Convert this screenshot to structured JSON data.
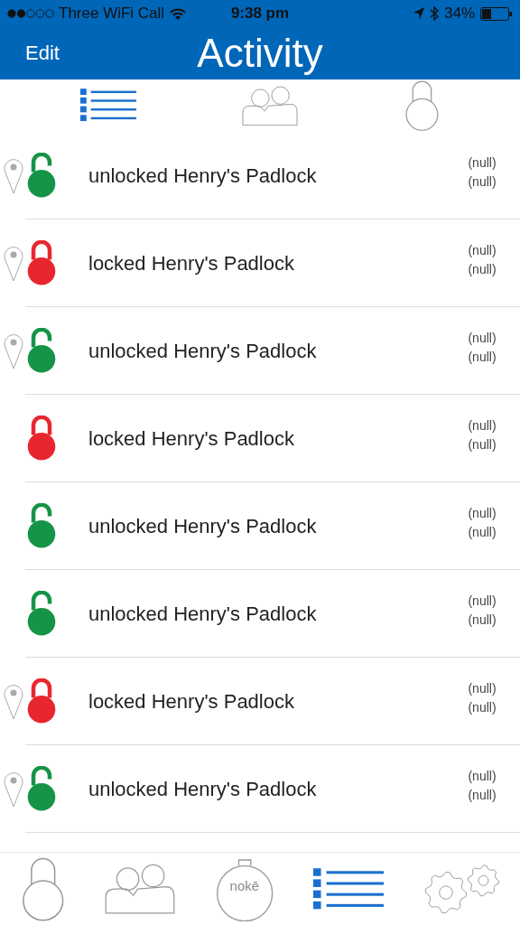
{
  "status_bar": {
    "carrier": "Three WiFi Call",
    "time": "9:38 pm",
    "battery": "34%"
  },
  "nav_bar": {
    "edit": "Edit",
    "title": "Activity"
  },
  "segments": [
    {
      "kind": "list",
      "selected": true
    },
    {
      "kind": "people",
      "selected": false
    },
    {
      "kind": "lock",
      "selected": false
    }
  ],
  "rows": [
    {
      "text": "unlocked Henry's Padlock",
      "locked": false,
      "location": true,
      "line_1": "(null)",
      "line_2": "(null)"
    },
    {
      "text": "locked Henry's Padlock",
      "locked": true,
      "location": true,
      "line_1": "(null)",
      "line_2": "(null)"
    },
    {
      "text": "unlocked Henry's Padlock",
      "locked": false,
      "location": true,
      "line_1": "(null)",
      "line_2": "(null)"
    },
    {
      "text": "locked Henry's Padlock",
      "locked": true,
      "location": false,
      "line_1": "(null)",
      "line_2": "(null)"
    },
    {
      "text": "unlocked Henry's Padlock",
      "locked": false,
      "location": false,
      "line_1": "(null)",
      "line_2": "(null)"
    },
    {
      "text": "unlocked Henry's Padlock",
      "locked": false,
      "location": false,
      "line_1": "(null)",
      "line_2": "(null)"
    },
    {
      "text": "locked Henry's Padlock",
      "locked": true,
      "location": true,
      "line_1": "(null)",
      "line_2": "(null)"
    },
    {
      "text": "unlocked Henry's Padlock",
      "locked": false,
      "location": true,
      "line_1": "(null)",
      "line_2": "(null)"
    }
  ],
  "tab_bar": [
    {
      "kind": "lock",
      "selected": false
    },
    {
      "kind": "people",
      "selected": false
    },
    {
      "kind": "noke",
      "label": "nokē",
      "selected": false
    },
    {
      "kind": "list",
      "selected": true
    },
    {
      "kind": "gears",
      "selected": false
    }
  ]
}
